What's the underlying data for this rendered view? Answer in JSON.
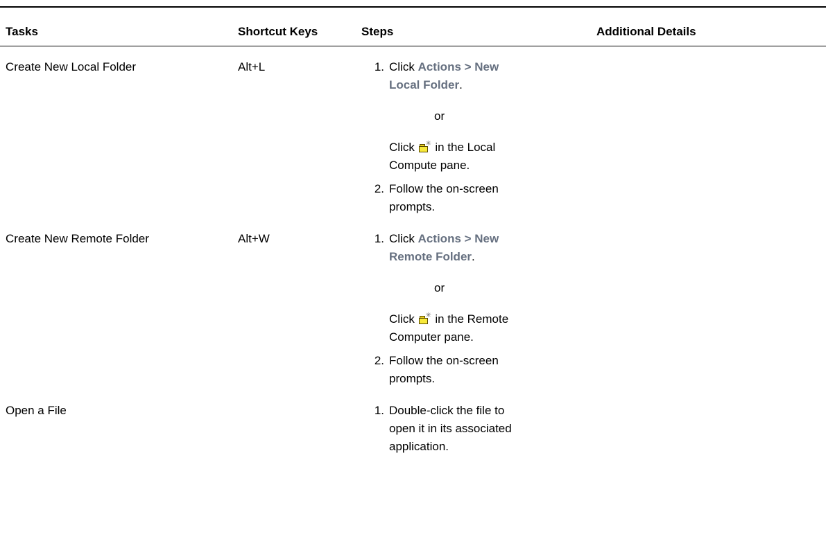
{
  "table": {
    "headers": {
      "tasks": "Tasks",
      "shortcut_keys": "Shortcut Keys",
      "steps": "Steps",
      "additional_details": "Additional Details"
    },
    "rows": [
      {
        "task": "Create New Local Folder",
        "shortcut": "Alt+L",
        "step1": {
          "num": "1.",
          "prefix": "Click ",
          "ui_ref_line1": "Actions > New",
          "ui_ref_line2": "Local Folder",
          "suffix": "."
        },
        "or": "or",
        "alt_line1_pre": "Click",
        "alt_line1_post": "in the Local",
        "alt_line2": "Compute pane.",
        "step2": {
          "num": "2.",
          "line1": "Follow the on-screen",
          "line2": "prompts."
        }
      },
      {
        "task": "Create New Remote Folder",
        "shortcut": "Alt+W",
        "step1": {
          "num": "1.",
          "prefix": "Click ",
          "ui_ref_line1": "Actions > New",
          "ui_ref_line2": "Remote Folder",
          "suffix": "."
        },
        "or": "or",
        "alt_line1_pre": "Click",
        "alt_line1_post": "in the Remote",
        "alt_line2": "Computer pane.",
        "step2": {
          "num": "2.",
          "line1": "Follow the on-screen",
          "line2": "prompts."
        }
      },
      {
        "task": "Open a File",
        "shortcut": "",
        "step1": {
          "num": "1.",
          "line1": "Double-click the file to",
          "line2": "open it in its associated",
          "line3": "application."
        }
      }
    ]
  },
  "icons": {
    "new_folder": "new-folder-icon"
  },
  "colors": {
    "ui_reference": "#667080",
    "folder_fill": "#f7e93a"
  }
}
